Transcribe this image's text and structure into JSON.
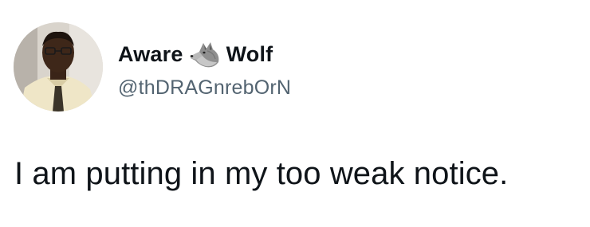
{
  "tweet": {
    "author": {
      "name_first": "Aware",
      "name_emoji": "wolf-emoji",
      "name_last": "Wolf",
      "handle": "@thDRAGnrebOrN",
      "avatar": "profile-photo"
    },
    "text": "I am putting in my too weak notice."
  }
}
